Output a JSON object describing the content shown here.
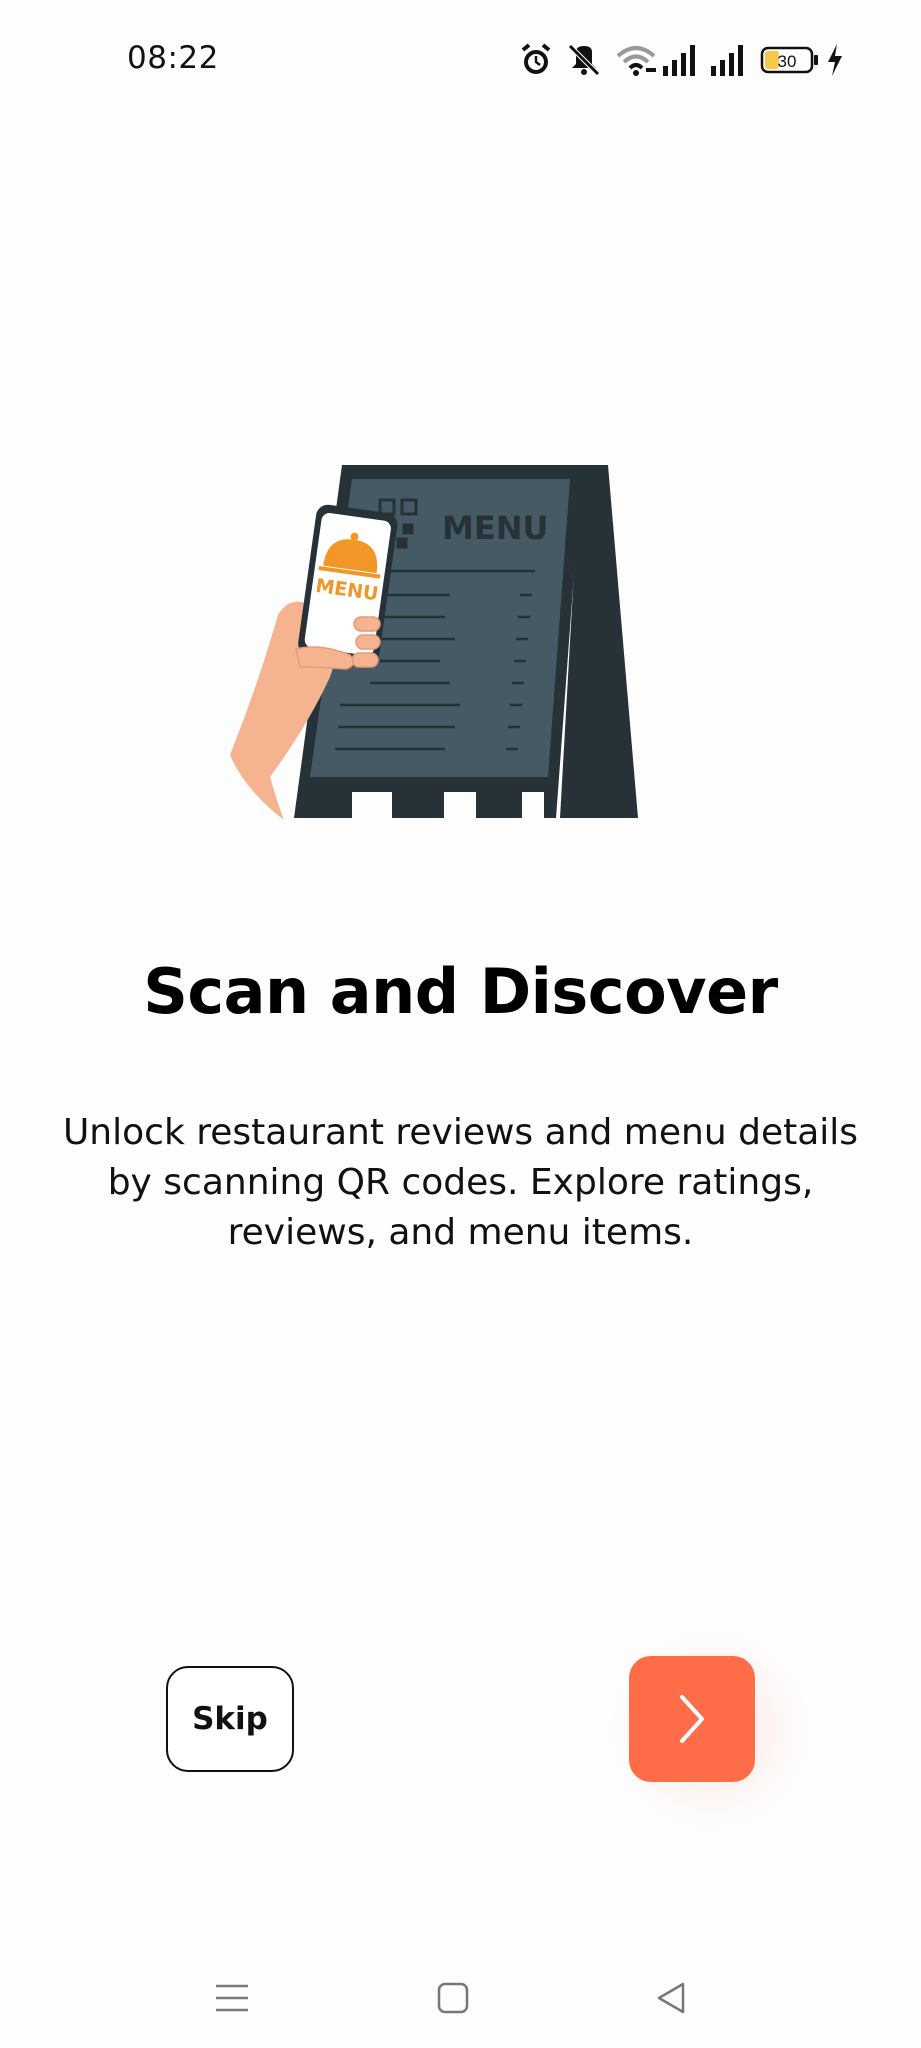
{
  "status_bar": {
    "time": "08:22",
    "battery_level": "30",
    "icons": [
      "alarm-icon",
      "mute-icon",
      "wifi-icon",
      "signal-icon",
      "signal-icon",
      "battery-icon",
      "charging-icon"
    ]
  },
  "illustration": {
    "menu_board_text": "MENU",
    "phone_text": "MENU"
  },
  "onboarding": {
    "title": "Scan and Discover",
    "description": "Unlock restaurant reviews and menu details by scanning QR codes. Explore ratings, reviews, and menu items."
  },
  "actions": {
    "skip_label": "Skip",
    "next_icon": "chevron-right-icon"
  },
  "nav_bar": {
    "icons": [
      "menu-icon",
      "home-icon",
      "back-icon"
    ]
  },
  "colors": {
    "accent": "#fe6d47",
    "board_dark": "#263238",
    "board_panel": "#455a64",
    "food_orange": "#f29727",
    "skin": "#f5b38f"
  }
}
